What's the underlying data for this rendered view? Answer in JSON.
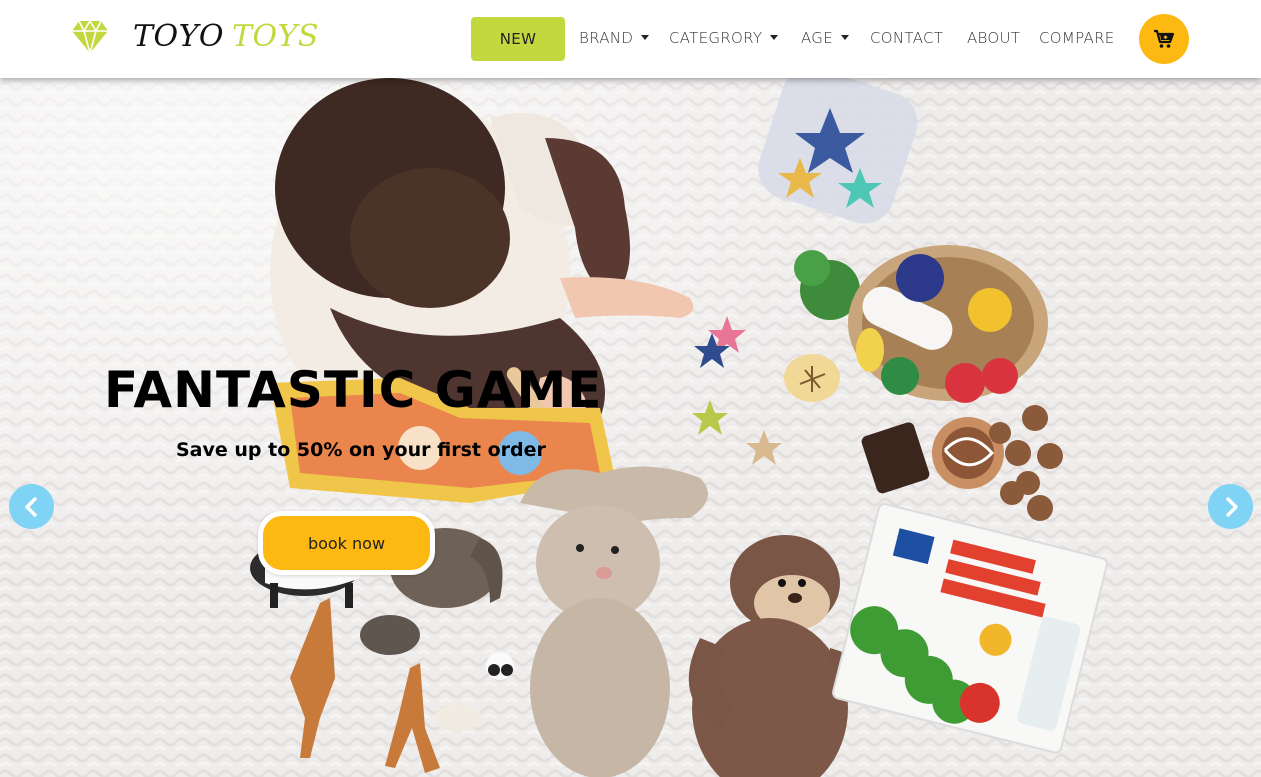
{
  "brand": {
    "word1": "TOYO",
    "word2": "TOYS",
    "accent_color": "#c3d83e",
    "logo_icon": "diamond-icon"
  },
  "nav": {
    "new_label": "NEW",
    "items": [
      {
        "label": "BRAND",
        "dropdown": true
      },
      {
        "label": "CATEGRORY",
        "dropdown": true
      },
      {
        "label": "AGE",
        "dropdown": true
      },
      {
        "label": "CONTACT",
        "dropdown": false
      },
      {
        "label": "ABOUT",
        "dropdown": false
      },
      {
        "label": "COMPARE",
        "dropdown": false
      }
    ],
    "cart_icon": "cart-icon",
    "cart_color": "#fdb912"
  },
  "hero": {
    "headline": "FANTASTIC GAME",
    "subline": "Save up to 50% on your first order",
    "button_label": "book now",
    "button_color": "#fdb912",
    "prev_icon": "chevron-left-icon",
    "next_icon": "chevron-right-icon",
    "arrow_color": "#7fd3f5"
  }
}
